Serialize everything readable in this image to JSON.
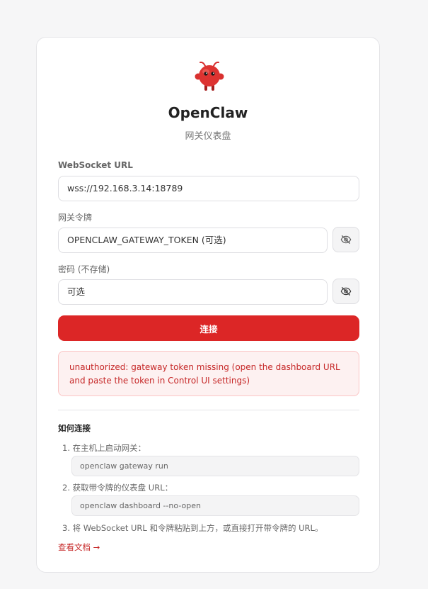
{
  "app": {
    "title": "OpenClaw",
    "subtitle": "网关仪表盘",
    "logo_icon": "crab-mascot-icon"
  },
  "form": {
    "websocket_label": "WebSocket URL",
    "websocket_value": "wss://192.168.3.14:18789",
    "token_label": "网关令牌",
    "token_placeholder": "OPENCLAW_GATEWAY_TOKEN (可选)",
    "password_label": "密码 (不存储)",
    "password_placeholder": "可选",
    "toggle_icon": "eye-off-icon",
    "connect_label": "连接"
  },
  "error": {
    "message": "unauthorized: gateway token missing (open the dashboard URL and paste the token in Control UI settings)"
  },
  "howto": {
    "title": "如何连接",
    "steps": [
      {
        "text": "1. 在主机上启动网关：",
        "code": "openclaw gateway run"
      },
      {
        "text": "2. 获取带令牌的仪表盘 URL：",
        "code": "openclaw dashboard --no-open"
      },
      {
        "text": "3. 将 WebSocket URL 和令牌粘贴到上方，或直接打开带令牌的 URL。"
      }
    ],
    "docs_link": "查看文档 →"
  },
  "colors": {
    "accent": "#dc2626",
    "error_text": "#c62828",
    "error_bg": "#fdf1f1"
  }
}
